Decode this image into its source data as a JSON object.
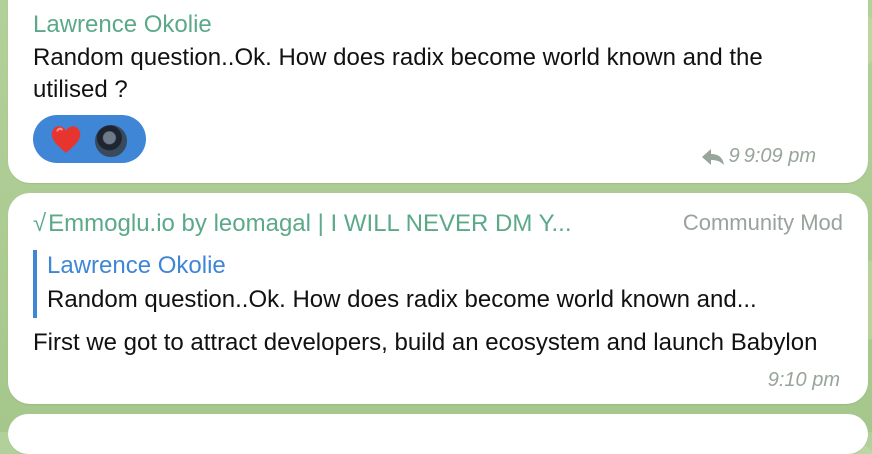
{
  "messages": [
    {
      "sender": "Lawrence Okolie",
      "text": "Random question..Ok. How does radix become world known and the utilised ?",
      "reaction": {
        "emoji": "heart-icon",
        "color": "#e8342f"
      },
      "reply_count": "9",
      "time": "9:09 pm"
    },
    {
      "sender": "Emmoglu.io by leomagal | I WILL NEVER DM Y...",
      "role": "Community Mod",
      "quote": {
        "name": "Lawrence Okolie",
        "text": "Random question..Ok. How does radix become world known and..."
      },
      "text": "First we got to attract developers, build an ecosystem and launch Babylon",
      "time": "9:10 pm"
    }
  ],
  "colors": {
    "sender_green": "#5ca98a",
    "accent_blue": "#3f86d7",
    "background": "#a9c98f"
  }
}
